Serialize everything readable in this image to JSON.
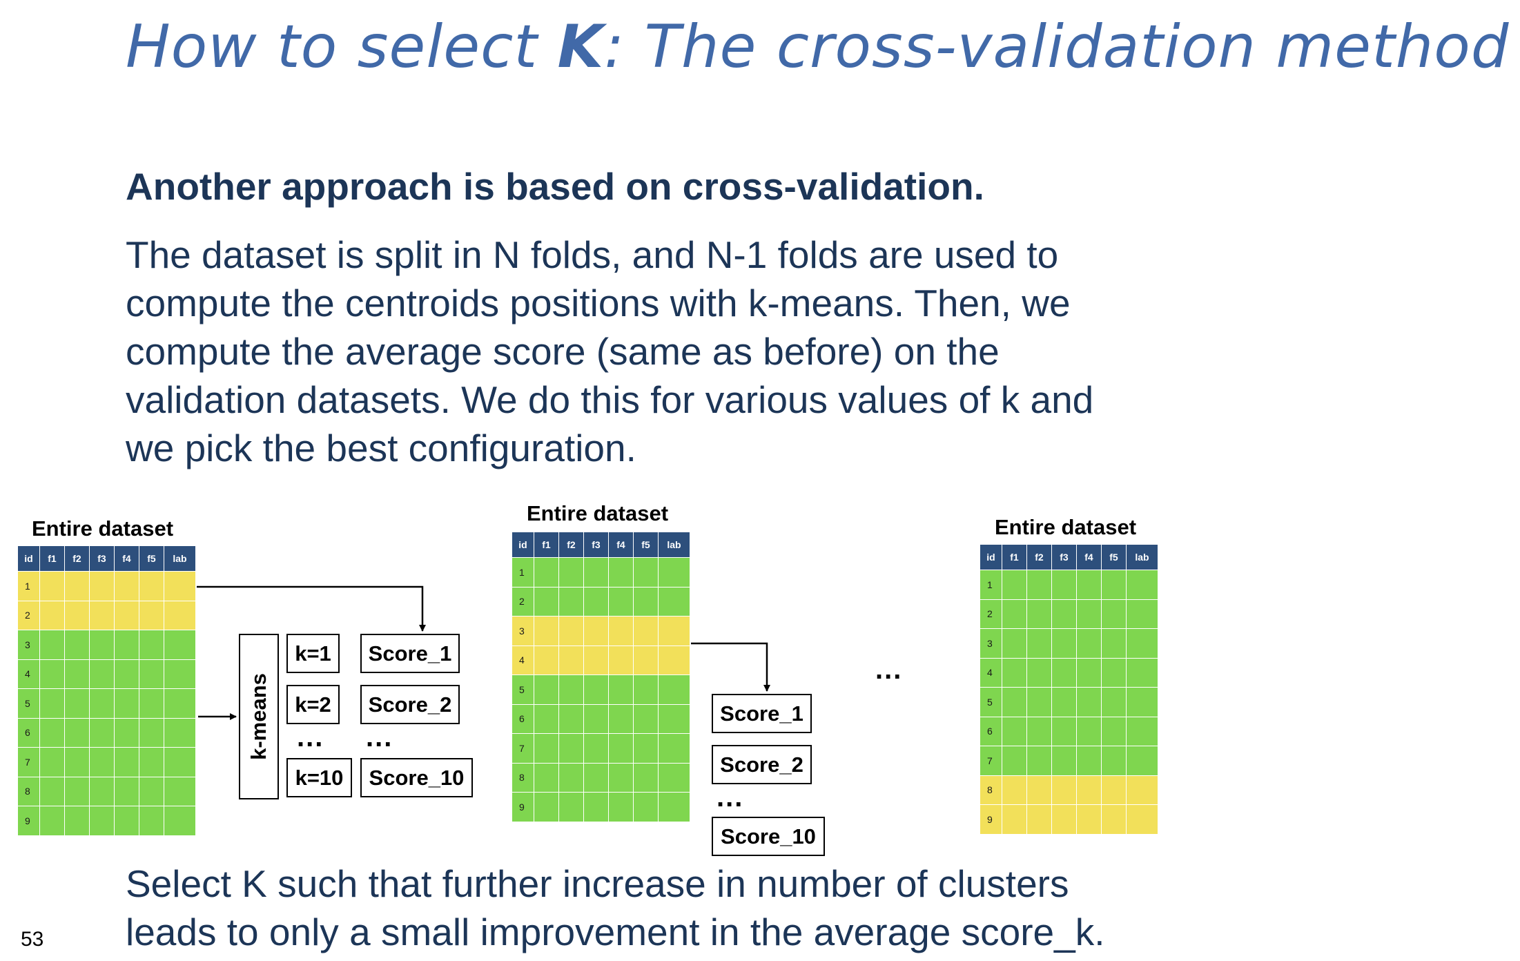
{
  "title": {
    "pre": "How to select ",
    "k": "K",
    "post": ": The cross-validation method"
  },
  "heading": "Another approach is based on cross-validation.",
  "paragraph": [
    "The dataset is split in N folds, and N-1 folds are used to",
    "compute the centroids positions with k-means. Then, we",
    "compute the average score (same as before) on the",
    "validation datasets. We do this for various values of k and",
    "we pick the best configuration."
  ],
  "conclusion": [
    "Select K such that further increase in number of clusters",
    "leads to only a small improvement in the average score_k."
  ],
  "page_number": "53",
  "dataset_label": "Entire dataset",
  "columns": [
    "id",
    "f1",
    "f2",
    "f3",
    "f4",
    "f5",
    "lab"
  ],
  "row_ids": [
    "1",
    "2",
    "3",
    "4",
    "5",
    "6",
    "7",
    "8",
    "9"
  ],
  "folds": [
    {
      "validation_rows": [
        "1",
        "2"
      ]
    },
    {
      "validation_rows": [
        "3",
        "4"
      ]
    },
    {
      "validation_rows": [
        "8",
        "9"
      ]
    }
  ],
  "kmeans_label": "k-means",
  "k_values": [
    "k=1",
    "k=2",
    "k=10"
  ],
  "scores_fold1": [
    "Score_1",
    "Score_2",
    "Score_10"
  ],
  "scores_fold2": [
    "Score_1",
    "Score_2",
    "Score_10"
  ],
  "ellipsis": "...",
  "colors": {
    "title": "#4169a8",
    "text": "#1c3557",
    "header": "#2d4f7c",
    "train": "#7fd64f",
    "validation": "#f2e05a"
  }
}
